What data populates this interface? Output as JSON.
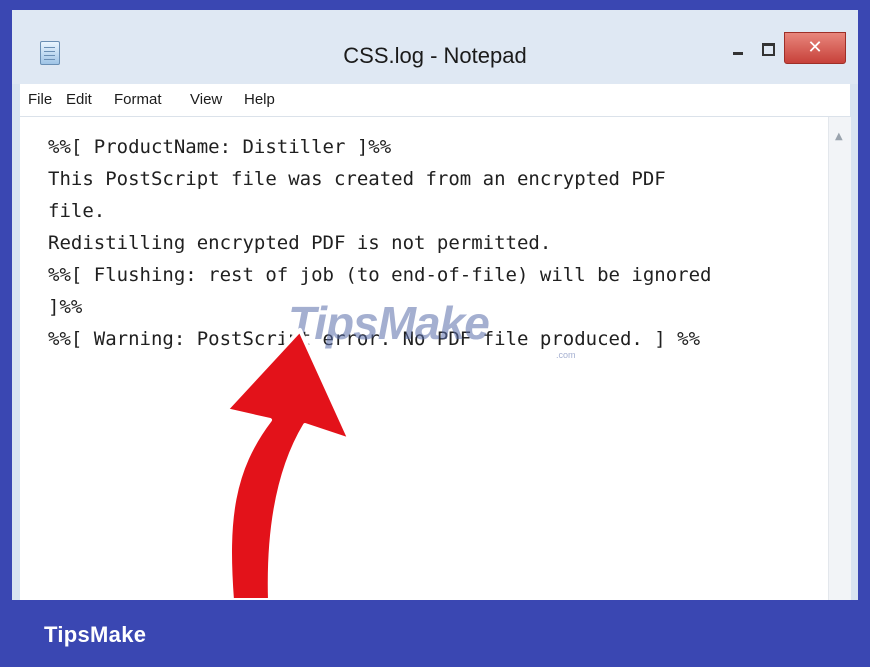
{
  "window": {
    "title": "CSS.log - Notepad",
    "close_glyph": "✕"
  },
  "menu": [
    "File",
    "Edit",
    "Format",
    "View",
    "Help"
  ],
  "editor": {
    "lines": [
      "%%[ ProductName: Distiller ]%%",
      "This PostScript file was created from an encrypted PDF",
      "file.",
      "Redistilling encrypted PDF is not permitted.",
      "%%[ Flushing: rest of job (to end-of-file) will be ignored",
      "]%%",
      "%%[ Warning: PostScript error. No PDF file produced. ] %%"
    ]
  },
  "watermark": {
    "text": "TipsMake",
    "suffix": ".com"
  },
  "footer": {
    "brand": "TipsMake"
  },
  "colors": {
    "frame": "#3a47b2",
    "arrow": "#e3121a"
  },
  "icons": {
    "app": "notepad-icon",
    "minimize": "minimize-icon",
    "maximize": "maximize-icon",
    "close": "close-icon",
    "scroll": "scroll-up-arrow-icon",
    "annotation": "red-arrow-icon"
  }
}
